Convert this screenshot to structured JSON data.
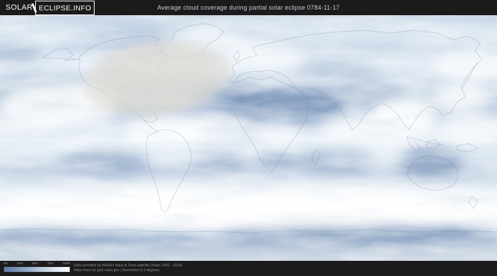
{
  "header": {
    "logo_left": "SOLAR",
    "logo_right": "ECLIPSE.INFO",
    "title": "Average cloud coverage during partial solar eclipse 0784-11-17"
  },
  "map": {
    "kind": "world-cloud-coverage-map",
    "legend_low_color": "#5f7dab",
    "legend_high_color": "#ffffff",
    "eclipse_shadow_color": "#dcd8d0"
  },
  "legend": {
    "ticks": [
      "0%",
      "25%",
      "50%",
      "75%",
      "100%"
    ]
  },
  "footer": {
    "attribution_line1": "Data provided by NASA's Aqua & Terra satellite (Years 2000 - 2019)",
    "attribution_line2": "https://neo.sci.gsfc.nasa.gov | Resolution 0.1 degrees"
  }
}
